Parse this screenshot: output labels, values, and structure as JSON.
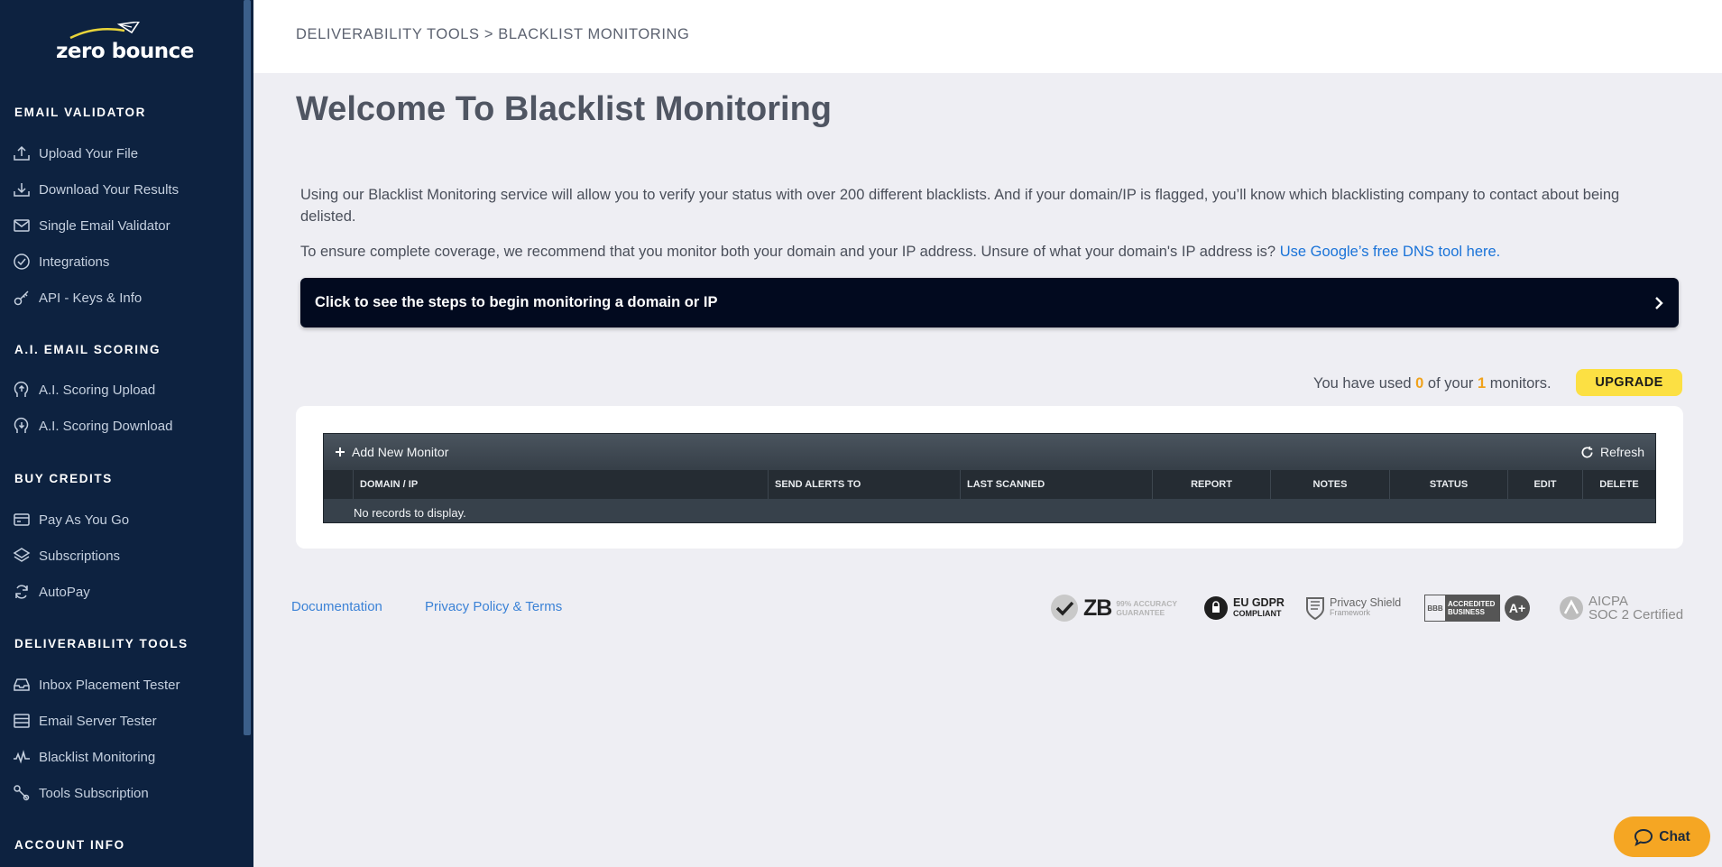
{
  "brand": {
    "logo_text": "zero bounce"
  },
  "sidebar": {
    "sections": [
      {
        "title": "EMAIL VALIDATOR",
        "items": [
          {
            "label": "Upload Your File",
            "icon": "upload-icon"
          },
          {
            "label": "Download Your Results",
            "icon": "download-icon"
          },
          {
            "label": "Single Email Validator",
            "icon": "envelope-icon"
          },
          {
            "label": "Integrations",
            "icon": "check-circle-icon"
          },
          {
            "label": "API - Keys & Info",
            "icon": "key-icon"
          }
        ]
      },
      {
        "title": "A.I. EMAIL SCORING",
        "items": [
          {
            "label": "A.I. Scoring Upload",
            "icon": "brain-upload-icon"
          },
          {
            "label": "A.I. Scoring Download",
            "icon": "brain-download-icon"
          }
        ]
      },
      {
        "title": "BUY CREDITS",
        "items": [
          {
            "label": "Pay As You Go",
            "icon": "credit-card-icon"
          },
          {
            "label": "Subscriptions",
            "icon": "layers-icon"
          },
          {
            "label": "AutoPay",
            "icon": "refresh-icon"
          }
        ]
      },
      {
        "title": "DELIVERABILITY TOOLS",
        "items": [
          {
            "label": "Inbox Placement Tester",
            "icon": "inbox-icon"
          },
          {
            "label": "Email Server Tester",
            "icon": "server-icon"
          },
          {
            "label": "Blacklist Monitoring",
            "icon": "pulse-icon"
          },
          {
            "label": "Tools Subscription",
            "icon": "tools-icon"
          }
        ]
      },
      {
        "title": "ACCOUNT INFO",
        "items": []
      }
    ]
  },
  "header": {
    "breadcrumb": "DELIVERABILITY TOOLS > BLACKLIST MONITORING"
  },
  "main": {
    "welcome_prefix": "Welcome To ",
    "welcome_bold": "Blacklist Monitoring",
    "intro_text": "Using our Blacklist Monitoring service will allow you to verify your status with over 200 different blacklists. And if your domain/IP is flagged, you’ll know which blacklisting company to contact about being delisted.",
    "coverage_text": "To ensure complete coverage, we recommend that you monitor both your domain and your IP address. Unsure of what your domain's IP address is? ",
    "dns_link": "Use Google’s free DNS tool here.",
    "steps_label": "Click to see the steps to begin monitoring a domain or IP",
    "usage": {
      "prefix": "You have used ",
      "used": "0",
      "middle": " of your ",
      "total": "1",
      "suffix": " monitors."
    },
    "upgrade_label": "UPGRADE"
  },
  "grid": {
    "add_label": "Add New Monitor",
    "refresh_label": "Refresh",
    "columns": [
      "DOMAIN / IP",
      "SEND ALERTS TO",
      "LAST SCANNED",
      "REPORT",
      "NOTES",
      "STATUS",
      "EDIT",
      "DELETE"
    ],
    "empty_text": "No records to display."
  },
  "footer": {
    "documentation": "Documentation",
    "privacy": "Privacy Policy & Terms",
    "badges": {
      "zb_main": "ZB",
      "zb_line1": "99% ACCURACY",
      "zb_line2": "GUARANTEE",
      "gdpr_line1": "EU GDPR",
      "gdpr_line2": "COMPLIANT",
      "shield_line1": "Privacy Shield",
      "shield_line2": "Framework",
      "bbb_small": "BBB",
      "bbb_line1": "ACCREDITED",
      "bbb_line2": "BUSINESS",
      "bbb_grade": "A+",
      "aicpa_line1": "AICPA",
      "aicpa_line2": "SOC 2 Certified"
    }
  },
  "chat": {
    "label": "Chat"
  },
  "colors": {
    "sidebar_bg": "#0d2240",
    "accent_yellow": "#fce043",
    "chat_orange": "#f5a623",
    "link_blue": "#1a73d8"
  }
}
